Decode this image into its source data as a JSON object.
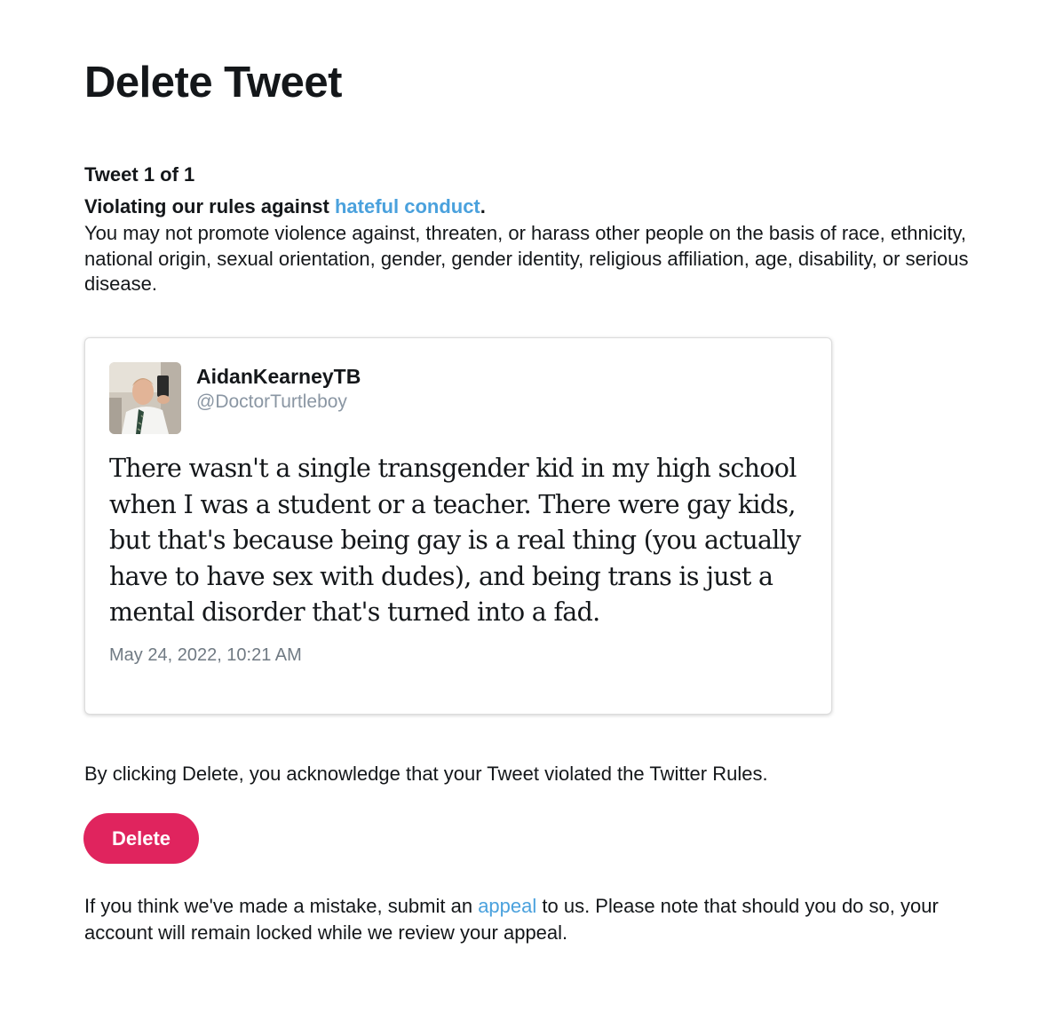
{
  "page": {
    "title": "Delete Tweet",
    "tweet_count": "Tweet 1 of 1"
  },
  "violation": {
    "prefix": "Violating our rules against ",
    "rule_link": "hateful conduct",
    "suffix": ".",
    "description": "You may not promote violence against, threaten, or harass other people on the basis of race, ethnicity, national origin, sexual orientation, gender, gender identity, religious affiliation, age, disability, or serious disease."
  },
  "tweet": {
    "display_name": "AidanKearneyTB",
    "handle": "@DoctorTurtleboy",
    "text": "There wasn't a single transgender kid in my high school when I was a student or a teacher. There were gay kids, but that's because being gay is a real thing (you actually have to have sex with dudes), and being trans is just a mental disorder that's turned into a fad.",
    "timestamp": "May 24, 2022, 10:21 AM",
    "avatar_icon": "user-selfie-photo"
  },
  "acknowledgement": "By clicking Delete, you acknowledge that your Tweet violated the Twitter Rules.",
  "delete_button": {
    "label": "Delete"
  },
  "appeal": {
    "prefix": "If you think we've made a mistake, submit an ",
    "link": "appeal",
    "suffix": " to us. Please note that should you do so, your account will remain locked while we review your appeal."
  },
  "colors": {
    "link": "#4aa1dd",
    "delete_button": "#e0245e",
    "handle": "#8a96a3",
    "timestamp": "#707a83"
  }
}
